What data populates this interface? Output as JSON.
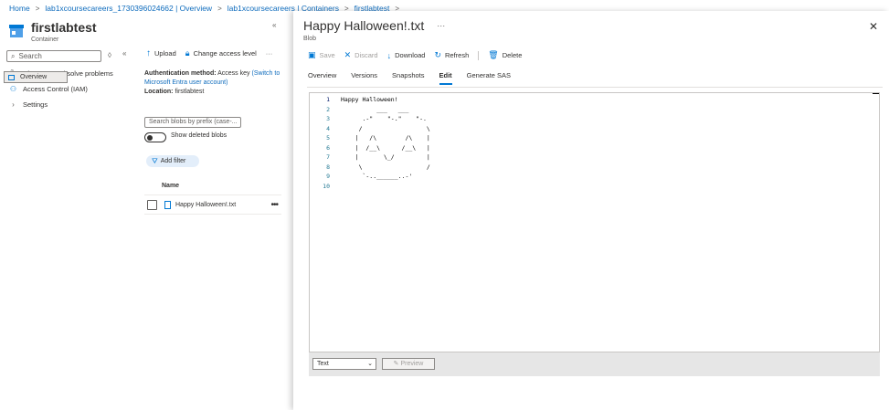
{
  "breadcrumb": [
    "Home",
    "lab1xcoursecareers_1730396024662 | Overview",
    "lab1xcoursecareers | Containers",
    "firstlabtest"
  ],
  "left": {
    "title": "firstlabtest",
    "subtitle": "Container",
    "search_placeholder": "Search",
    "collapse_glyph": "«",
    "nav": [
      {
        "label": "Overview",
        "icon": "overview-icon"
      },
      {
        "label": "Diagnose and solve problems",
        "icon": "wrench-icon"
      },
      {
        "label": "Access Control (IAM)",
        "icon": "people-icon"
      },
      {
        "label": "Settings",
        "icon": "chevron-right-icon"
      }
    ],
    "toolbar": {
      "upload": "Upload",
      "change_access": "Change access level",
      "more": "···"
    },
    "auth": {
      "method_label": "Authentication method:",
      "method_value": "Access key",
      "switch_link": "(Switch to Microsoft Entra user account)",
      "location_label": "Location:",
      "location_value": "firstlabtest"
    },
    "blob_search_placeholder": "Search blobs by prefix (case-...",
    "show_deleted": "Show deleted blobs",
    "add_filter": "Add filter",
    "name_header": "Name",
    "rows": [
      {
        "name": "Happy Halloween!.txt"
      }
    ]
  },
  "right": {
    "title": "Happy Halloween!.txt",
    "title_more": "···",
    "subtitle": "Blob",
    "close": "✕",
    "toolbar": {
      "save": "Save",
      "discard": "Discard",
      "download": "Download",
      "refresh": "Refresh",
      "delete": "Delete"
    },
    "tabs": [
      "Overview",
      "Versions",
      "Snapshots",
      "Edit",
      "Generate SAS"
    ],
    "active_tab": "Edit",
    "line_numbers": [
      "1",
      "2",
      "3",
      "4",
      "5",
      "6",
      "7",
      "8",
      "9",
      "10"
    ],
    "code_lines": [
      "Happy Halloween!",
      "          ___   ___",
      "      .-\"    \"-.\"    \"-.",
      "     /                  \\",
      "    |   /\\        /\\    |",
      "    |  /__\\      /__\\   |",
      "    |       \\_/         |",
      "     \\                  /",
      "      `-..______..-'",
      ""
    ],
    "content_type": "Text",
    "preview": "Preview"
  }
}
